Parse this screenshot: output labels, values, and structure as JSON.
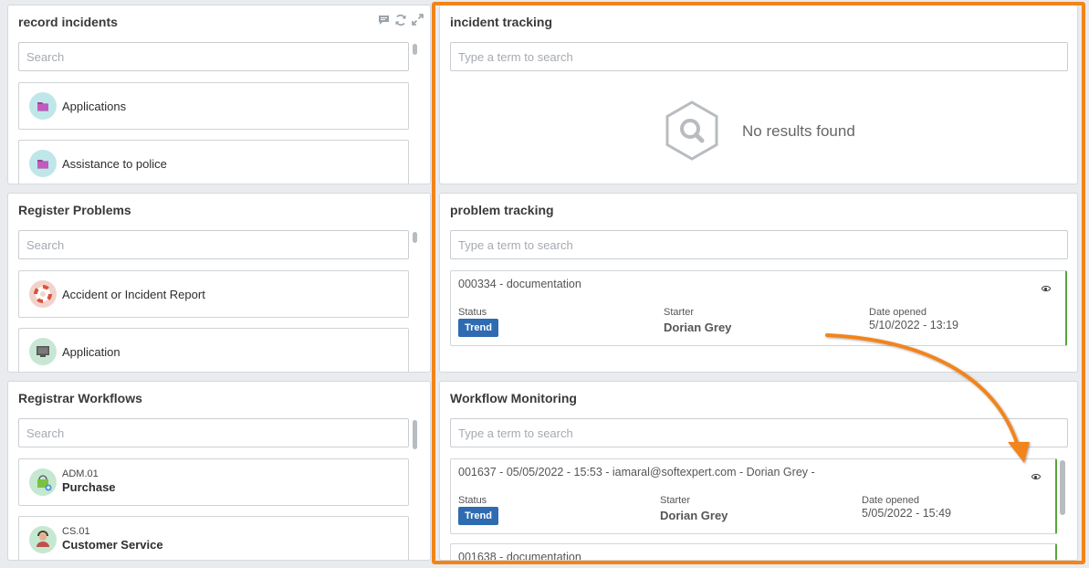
{
  "record_incidents": {
    "title": "record incidents",
    "search_placeholder": "Search",
    "items": [
      {
        "label": "Applications",
        "icon": "folder-icon"
      },
      {
        "label": "Assistance to police",
        "icon": "folder-icon"
      }
    ]
  },
  "register_problems": {
    "title": "Register Problems",
    "search_placeholder": "Search",
    "items": [
      {
        "label": "Accident or Incident Report",
        "icon": "lifebuoy-icon"
      },
      {
        "label": "Application",
        "icon": "monitor-icon"
      }
    ]
  },
  "registrar_workflows": {
    "title": "Registrar Workflows",
    "search_placeholder": "Search",
    "items": [
      {
        "code": "ADM.01",
        "name": "Purchase",
        "icon": "shopping-bag-icon"
      },
      {
        "code": "CS.01",
        "name": "Customer Service",
        "icon": "support-agent-icon"
      }
    ]
  },
  "incident_tracking": {
    "title": "incident tracking",
    "search_placeholder": "Type a term to search",
    "empty_text": "No results found"
  },
  "problem_tracking": {
    "title": "problem tracking",
    "search_placeholder": "Type a term to search",
    "records": [
      {
        "title": "000334 - documentation",
        "status_label": "Status",
        "status": "Trend",
        "starter_label": "Starter",
        "starter": "Dorian Grey",
        "date_label": "Date opened",
        "date": "5/10/2022 - 13:19"
      }
    ]
  },
  "workflow_monitoring": {
    "title": "Workflow Monitoring",
    "search_placeholder": "Type a term to search",
    "records": [
      {
        "title": "001637 - 05/05/2022 - 15:53 - iamaral@softexpert.com - Dorian Grey -",
        "status_label": "Status",
        "status": "Trend",
        "starter_label": "Starter",
        "starter": "Dorian Grey",
        "date_label": "Date opened",
        "date": "5/05/2022 - 15:49"
      },
      {
        "title": "001638 - documentation"
      }
    ]
  },
  "colors": {
    "highlight": "#f2841a",
    "badge": "#2e6bb0",
    "record_accent": "#58a63d"
  }
}
